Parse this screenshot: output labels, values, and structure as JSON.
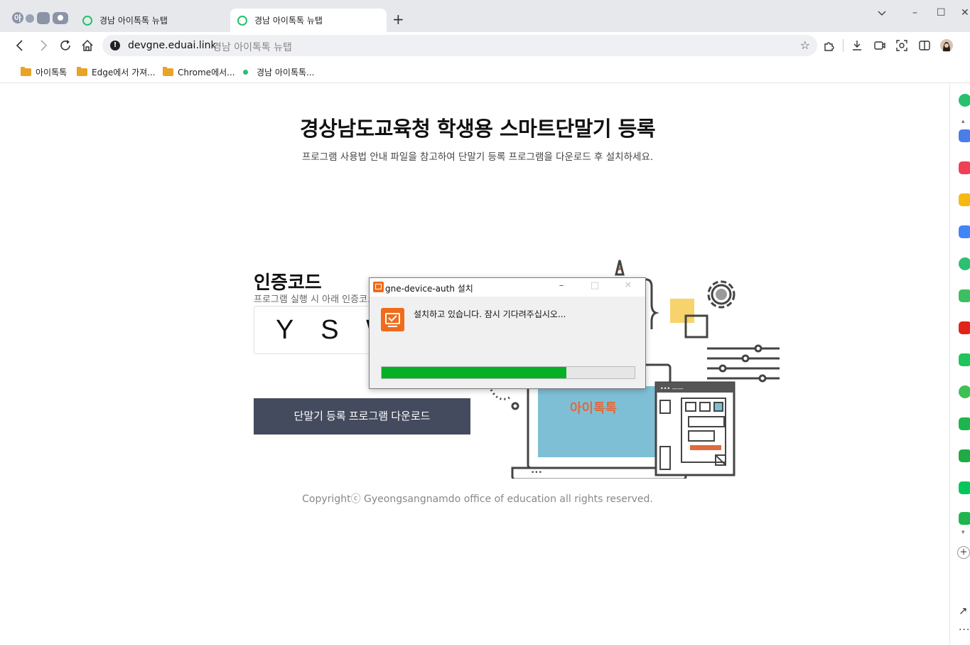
{
  "browser": {
    "tabs": [
      {
        "title": "경남 아이톡톡 뉴탭",
        "active": false
      },
      {
        "title": "경남 아이톡톡 뉴탭",
        "active": true
      }
    ],
    "new_tab_glyph": "+",
    "window_controls": {
      "minimize": "–",
      "maximize": "☐",
      "close": "✕"
    },
    "address": {
      "host": "devgne.eduai.link",
      "page_title": "경남 아이톡톡 뉴탭"
    },
    "bookmarks": [
      {
        "label": "아이톡톡",
        "type": "folder"
      },
      {
        "label": "Edge에서 가져...",
        "type": "folder"
      },
      {
        "label": "Chrome에서...",
        "type": "folder"
      },
      {
        "label": "경남 아이톡톡...",
        "type": "site"
      }
    ],
    "accent_color": "#27c06d"
  },
  "page": {
    "title": "경상남도교육청 학생용 스마트단말기 등록",
    "subtitle": "프로그램 사용법 안내 파일을 참고하여 단말기 등록 프로그램을 다운로드 후 설치하세요.",
    "auth": {
      "title": "인증코드",
      "description": "프로그램 실행 시 아래 인증코드를 입력하세요.",
      "code": "Y S W"
    },
    "download_button": "단말기 등록 프로그램 다운로드",
    "copyright": "Copyrightⓒ Gyeongsangnamdo office of education all rights reserved.",
    "button_color": "#454b5e"
  },
  "installer": {
    "title": "gne-device-auth 설치",
    "status": "설치하고 있습니다. 잠시 기다려주십시오...",
    "controls": {
      "minimize": "–",
      "maximize": "□",
      "close": "✕"
    },
    "progress": 0.73,
    "progress_color": "#06b025",
    "icon_color": "#f06b1a"
  },
  "sidebar": {
    "add_glyph": "+",
    "more_glyph": "···",
    "items": [
      {
        "icon": "green-circle-icon",
        "color": "#27c06d"
      },
      {
        "icon": "calendar-icon",
        "color": "#4a7de8"
      },
      {
        "icon": "pocket-icon",
        "color": "#ef4056"
      },
      {
        "icon": "star-icon",
        "color": "#f5b914"
      },
      {
        "icon": "google-icon",
        "color": "#4285f4"
      },
      {
        "icon": "play-icon",
        "color": "#2fbf71"
      },
      {
        "icon": "welcome-icon",
        "color": "#3cbf62"
      },
      {
        "icon": "news-icon",
        "color": "#e2231a"
      },
      {
        "icon": "chat-icon",
        "color": "#21c35b"
      },
      {
        "icon": "b-icon",
        "color": "#3fbf55"
      },
      {
        "icon": "blog-icon",
        "color": "#1fb54e"
      },
      {
        "icon": "cafe-icon",
        "color": "#1fab46"
      },
      {
        "icon": "naver-icon",
        "color": "#03c75a"
      },
      {
        "icon": "map-icon",
        "color": "#1fb54e"
      }
    ]
  }
}
